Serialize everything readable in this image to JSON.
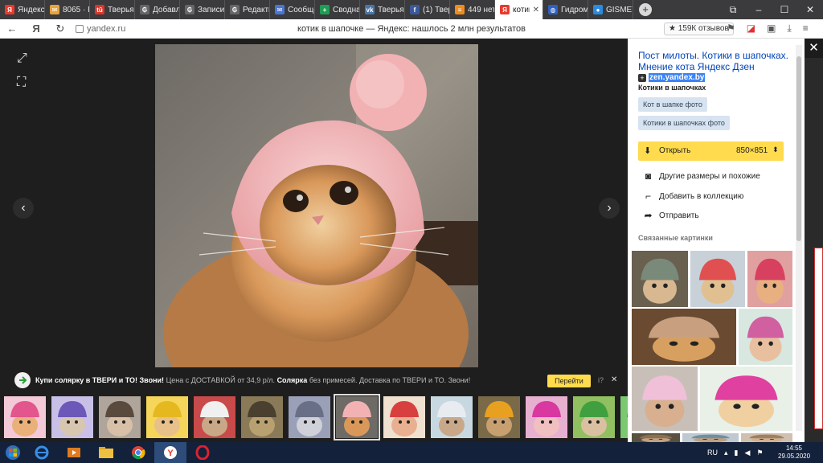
{
  "browser": {
    "tabs": [
      {
        "label": "Яндекс",
        "icon": "yandex-icon",
        "color": "#e63b2e",
        "glyph": "Я"
      },
      {
        "label": "8065 · В",
        "icon": "mail-icon",
        "color": "#e8a33a",
        "glyph": "✉"
      },
      {
        "label": "Тверья",
        "icon": "news-icon",
        "color": "#d9362b",
        "glyph": "tū"
      },
      {
        "label": "Добавл",
        "icon": "forum-icon",
        "color": "#666666",
        "glyph": "₲"
      },
      {
        "label": "Записи",
        "icon": "forum-icon",
        "color": "#666666",
        "glyph": "₲"
      },
      {
        "label": "Редакти",
        "icon": "forum-icon",
        "color": "#666666",
        "glyph": "₲"
      },
      {
        "label": "Сообще",
        "icon": "chat-icon",
        "color": "#4a76d1",
        "glyph": "✉"
      },
      {
        "label": "Сводна",
        "icon": "sheets-icon",
        "color": "#1f9d55",
        "glyph": "+"
      },
      {
        "label": "Тверья",
        "icon": "vk-icon",
        "color": "#4a76a8",
        "glyph": "vk"
      },
      {
        "label": "(1) Твер",
        "icon": "facebook-icon",
        "color": "#3b5998",
        "glyph": "f"
      },
      {
        "label": "449 нет",
        "icon": "rss-icon",
        "color": "#f08c1c",
        "glyph": "≡"
      }
    ],
    "active_tab": {
      "label": "котик",
      "icon": "yandex-icon",
      "color": "#e63b2e",
      "glyph": "Я"
    },
    "after_tabs": [
      {
        "label": "Гидром",
        "icon": "globe-icon",
        "color": "#3060c0",
        "glyph": "◍"
      },
      {
        "label": "GISMETI",
        "icon": "drop-icon",
        "color": "#2a8be0",
        "glyph": "●"
      }
    ],
    "address": "yandex.ru",
    "page_title": "котик в шапочке — Яндекс: нашлось 2 млн результатов",
    "reviews_badge": "★ 159К отзывов"
  },
  "ad": {
    "headline": "Купи солярку в ТВЕРИ и ТО! Звони!",
    "text_1": "Цена с ДОСТАВКОЙ от 34,9 р/л.",
    "bold_2": "Солярка",
    "text_3": "без примесей. Доставка по ТВЕРИ и ТО. Звони!",
    "button": "Перейти",
    "mark": "i?"
  },
  "panel": {
    "title": "Пост милоты. Котики в шапочках. Мнение кота Яндекс Дзен",
    "domain": "zen.yandex.by",
    "subtitle": "Котики в шапочках",
    "tags": [
      "Кот в шапке фото",
      "Котики в шапочках фото"
    ],
    "open_button": "Открыть",
    "size": "850×851",
    "actions": [
      {
        "label": "Другие размеры и похожие",
        "icon": "camera-icon"
      },
      {
        "label": "Добавить в коллекцию",
        "icon": "bookmark-icon"
      },
      {
        "label": "Отправить",
        "icon": "share-icon"
      }
    ],
    "related_title": "Связанные картинки"
  },
  "taskbar": {
    "lang": "RU",
    "time": "14:55",
    "date": "29.05.2020"
  },
  "colors": {
    "accent_yellow": "#ffdb4d",
    "link_blue": "#0044bb",
    "viewer_bg": "#1e1e1e",
    "hat_pink": "#f2b2b4",
    "cat_orange": "#d9985a"
  }
}
